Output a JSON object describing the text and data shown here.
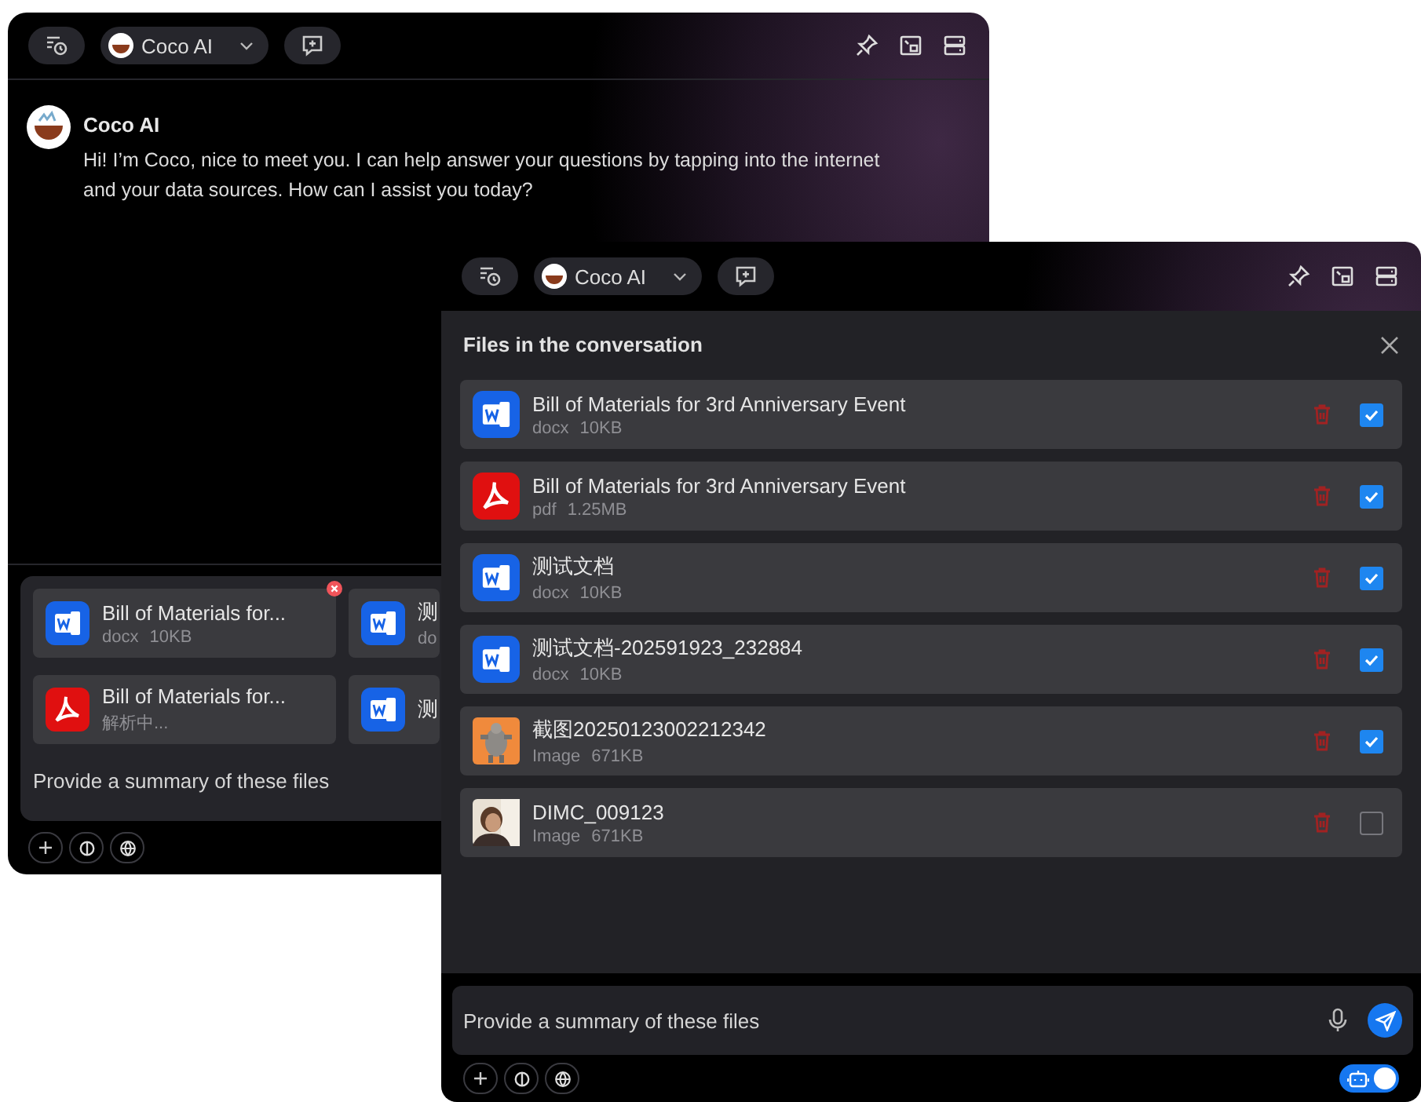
{
  "back_window": {
    "toolbar": {
      "assistant": "Coco AI"
    },
    "message": {
      "sender": "Coco AI",
      "text": "Hi! I’m Coco, nice to meet you. I can help answer your questions by tapping into the internet and your data sources. How can I assist you today?"
    },
    "attachments": [
      {
        "kind": "docx",
        "name": "Bill of Materials for...",
        "meta": "docx 10KB",
        "removable": true
      },
      {
        "kind": "docx",
        "name": "测",
        "meta": "do",
        "removable": false
      },
      {
        "kind": "pdf",
        "name": "Bill of Materials for...",
        "meta": "解析中...",
        "removable": false
      },
      {
        "kind": "docx",
        "name": "测",
        "removable": false
      }
    ],
    "input": {
      "value": "Provide a summary of these files"
    }
  },
  "front_window": {
    "toolbar": {
      "assistant": "Coco AI"
    },
    "files_panel": {
      "title": "Files in the conversation",
      "files": [
        {
          "kind": "docx",
          "name": "Bill of Materials for 3rd Anniversary Event",
          "meta": "docx 10KB",
          "checked": true
        },
        {
          "kind": "pdf",
          "name": "Bill of Materials for 3rd Anniversary Event",
          "meta": "pdf 1.25MB",
          "checked": true
        },
        {
          "kind": "docx",
          "name": "测试文档",
          "meta": "docx 10KB",
          "checked": true
        },
        {
          "kind": "docx",
          "name": "测试文档-202591923_232884",
          "meta": "docx 10KB",
          "checked": true
        },
        {
          "name": "截图20250123002212342",
          "meta": "Image 671KB",
          "checked": true
        },
        {
          "name": "DIMC_009123",
          "meta": "Image 671KB",
          "checked": false
        }
      ]
    },
    "input": {
      "value": "Provide a summary of these files"
    },
    "robot_toggle": {
      "on": true
    }
  }
}
